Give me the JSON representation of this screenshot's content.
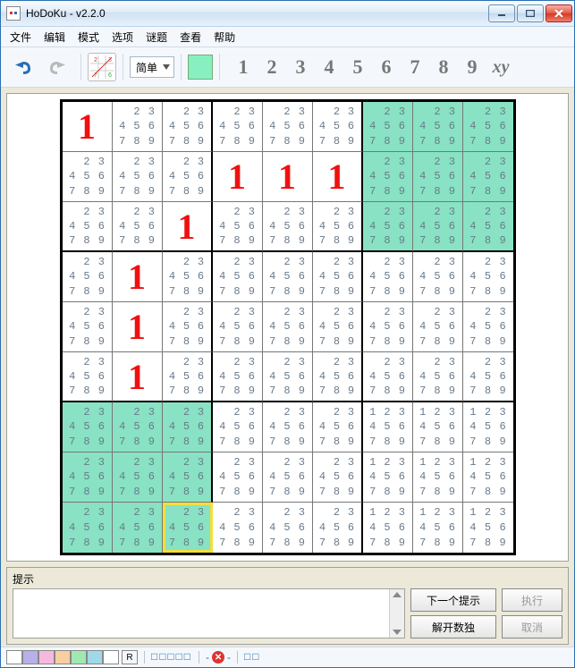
{
  "window": {
    "title": "HoDoKu - v2.2.0"
  },
  "menu": {
    "items": [
      "文件",
      "编辑",
      "模式",
      "选项",
      "谜题",
      "查看",
      "帮助"
    ]
  },
  "toolbar": {
    "difficulty_label": "简单",
    "numbers": [
      "1",
      "2",
      "3",
      "4",
      "5",
      "6",
      "7",
      "8",
      "9"
    ],
    "xy_label": "xy"
  },
  "hint": {
    "label": "提示",
    "btn_next": "下一个提示",
    "btn_solve": "解开数独",
    "btn_exec": "执行",
    "btn_cancel": "取消"
  },
  "status": {
    "palette": [
      "#ffffff",
      "#b8b0e8",
      "#f7b8e0",
      "#f7cfa0",
      "#a0e8b0",
      "#a0d8e8",
      "#ffffff"
    ],
    "r_label": "R",
    "boxes_text": "□□□□□",
    "boxes_text2": "□□"
  },
  "sudoku": {
    "selected": [
      8,
      2
    ],
    "cells": [
      [
        {
          "v": 1
        },
        {
          "c": [
            2,
            3,
            4,
            5,
            6,
            7,
            8,
            9
          ]
        },
        {
          "c": [
            2,
            3,
            4,
            5,
            6,
            7,
            8,
            9
          ]
        },
        {
          "c": [
            2,
            3,
            4,
            5,
            6,
            7,
            8,
            9
          ]
        },
        {
          "c": [
            2,
            3,
            4,
            5,
            6,
            7,
            8,
            9
          ]
        },
        {
          "c": [
            2,
            3,
            4,
            5,
            6,
            7,
            8,
            9
          ]
        },
        {
          "c": [
            2,
            3,
            4,
            5,
            6,
            7,
            8,
            9
          ],
          "hl": true
        },
        {
          "c": [
            2,
            3,
            4,
            5,
            6,
            7,
            8,
            9
          ],
          "hl": true
        },
        {
          "c": [
            2,
            3,
            4,
            5,
            6,
            7,
            8,
            9
          ],
          "hl": true
        }
      ],
      [
        {
          "c": [
            2,
            3,
            4,
            5,
            6,
            7,
            8,
            9
          ]
        },
        {
          "c": [
            2,
            3,
            4,
            5,
            6,
            7,
            8,
            9
          ]
        },
        {
          "c": [
            2,
            3,
            4,
            5,
            6,
            7,
            8,
            9
          ]
        },
        {
          "v": 1
        },
        {
          "v": 1
        },
        {
          "v": 1
        },
        {
          "c": [
            2,
            3,
            4,
            5,
            6,
            7,
            8,
            9
          ],
          "hl": true
        },
        {
          "c": [
            2,
            3,
            4,
            5,
            6,
            7,
            8,
            9
          ],
          "hl": true
        },
        {
          "c": [
            2,
            3,
            4,
            5,
            6,
            7,
            8,
            9
          ],
          "hl": true
        }
      ],
      [
        {
          "c": [
            2,
            3,
            4,
            5,
            6,
            7,
            8,
            9
          ]
        },
        {
          "c": [
            2,
            3,
            4,
            5,
            6,
            7,
            8,
            9
          ]
        },
        {
          "v": 1
        },
        {
          "c": [
            2,
            3,
            4,
            5,
            6,
            7,
            8,
            9
          ]
        },
        {
          "c": [
            2,
            3,
            4,
            5,
            6,
            7,
            8,
            9
          ]
        },
        {
          "c": [
            2,
            3,
            4,
            5,
            6,
            7,
            8,
            9
          ]
        },
        {
          "c": [
            2,
            3,
            4,
            5,
            6,
            7,
            8,
            9
          ],
          "hl": true
        },
        {
          "c": [
            2,
            3,
            4,
            5,
            6,
            7,
            8,
            9
          ],
          "hl": true
        },
        {
          "c": [
            2,
            3,
            4,
            5,
            6,
            7,
            8,
            9
          ],
          "hl": true
        }
      ],
      [
        {
          "c": [
            2,
            3,
            4,
            5,
            6,
            7,
            8,
            9
          ]
        },
        {
          "v": 1
        },
        {
          "c": [
            2,
            3,
            4,
            5,
            6,
            7,
            8,
            9
          ]
        },
        {
          "c": [
            2,
            3,
            4,
            5,
            6,
            7,
            8,
            9
          ]
        },
        {
          "c": [
            2,
            3,
            4,
            5,
            6,
            7,
            8,
            9
          ]
        },
        {
          "c": [
            2,
            3,
            4,
            5,
            6,
            7,
            8,
            9
          ]
        },
        {
          "c": [
            2,
            3,
            4,
            5,
            6,
            7,
            8,
            9
          ]
        },
        {
          "c": [
            2,
            3,
            4,
            5,
            6,
            7,
            8,
            9
          ]
        },
        {
          "c": [
            2,
            3,
            4,
            5,
            6,
            7,
            8,
            9
          ]
        }
      ],
      [
        {
          "c": [
            2,
            3,
            4,
            5,
            6,
            7,
            8,
            9
          ]
        },
        {
          "v": 1
        },
        {
          "c": [
            2,
            3,
            4,
            5,
            6,
            7,
            8,
            9
          ]
        },
        {
          "c": [
            2,
            3,
            4,
            5,
            6,
            7,
            8,
            9
          ]
        },
        {
          "c": [
            2,
            3,
            4,
            5,
            6,
            7,
            8,
            9
          ]
        },
        {
          "c": [
            2,
            3,
            4,
            5,
            6,
            7,
            8,
            9
          ]
        },
        {
          "c": [
            2,
            3,
            4,
            5,
            6,
            7,
            8,
            9
          ]
        },
        {
          "c": [
            2,
            3,
            4,
            5,
            6,
            7,
            8,
            9
          ]
        },
        {
          "c": [
            2,
            3,
            4,
            5,
            6,
            7,
            8,
            9
          ]
        }
      ],
      [
        {
          "c": [
            2,
            3,
            4,
            5,
            6,
            7,
            8,
            9
          ]
        },
        {
          "v": 1
        },
        {
          "c": [
            2,
            3,
            4,
            5,
            6,
            7,
            8,
            9
          ]
        },
        {
          "c": [
            2,
            3,
            4,
            5,
            6,
            7,
            8,
            9
          ]
        },
        {
          "c": [
            2,
            3,
            4,
            5,
            6,
            7,
            8,
            9
          ]
        },
        {
          "c": [
            2,
            3,
            4,
            5,
            6,
            7,
            8,
            9
          ]
        },
        {
          "c": [
            2,
            3,
            4,
            5,
            6,
            7,
            8,
            9
          ]
        },
        {
          "c": [
            2,
            3,
            4,
            5,
            6,
            7,
            8,
            9
          ]
        },
        {
          "c": [
            2,
            3,
            4,
            5,
            6,
            7,
            8,
            9
          ]
        }
      ],
      [
        {
          "c": [
            2,
            3,
            4,
            5,
            6,
            7,
            8,
            9
          ],
          "hl": true
        },
        {
          "c": [
            2,
            3,
            4,
            5,
            6,
            7,
            8,
            9
          ],
          "hl": true
        },
        {
          "c": [
            2,
            3,
            4,
            5,
            6,
            7,
            8,
            9
          ],
          "hl": true
        },
        {
          "c": [
            2,
            3,
            4,
            5,
            6,
            7,
            8,
            9
          ]
        },
        {
          "c": [
            2,
            3,
            4,
            5,
            6,
            7,
            8,
            9
          ]
        },
        {
          "c": [
            2,
            3,
            4,
            5,
            6,
            7,
            8,
            9
          ]
        },
        {
          "c": [
            1,
            2,
            3,
            4,
            5,
            6,
            7,
            8,
            9
          ]
        },
        {
          "c": [
            1,
            2,
            3,
            4,
            5,
            6,
            7,
            8,
            9
          ]
        },
        {
          "c": [
            1,
            2,
            3,
            4,
            5,
            6,
            7,
            8,
            9
          ]
        }
      ],
      [
        {
          "c": [
            2,
            3,
            4,
            5,
            6,
            7,
            8,
            9
          ],
          "hl": true
        },
        {
          "c": [
            2,
            3,
            4,
            5,
            6,
            7,
            8,
            9
          ],
          "hl": true
        },
        {
          "c": [
            2,
            3,
            4,
            5,
            6,
            7,
            8,
            9
          ],
          "hl": true
        },
        {
          "c": [
            2,
            3,
            4,
            5,
            6,
            7,
            8,
            9
          ]
        },
        {
          "c": [
            2,
            3,
            4,
            5,
            6,
            7,
            8,
            9
          ]
        },
        {
          "c": [
            2,
            3,
            4,
            5,
            6,
            7,
            8,
            9
          ]
        },
        {
          "c": [
            1,
            2,
            3,
            4,
            5,
            6,
            7,
            8,
            9
          ]
        },
        {
          "c": [
            1,
            2,
            3,
            4,
            5,
            6,
            7,
            8,
            9
          ]
        },
        {
          "c": [
            1,
            2,
            3,
            4,
            5,
            6,
            7,
            8,
            9
          ]
        }
      ],
      [
        {
          "c": [
            2,
            3,
            4,
            5,
            6,
            7,
            8,
            9
          ],
          "hl": true
        },
        {
          "c": [
            2,
            3,
            4,
            5,
            6,
            7,
            8,
            9
          ],
          "hl": true
        },
        {
          "c": [
            2,
            3,
            4,
            5,
            6,
            7,
            8,
            9
          ],
          "hl": true
        },
        {
          "c": [
            2,
            3,
            4,
            5,
            6,
            7,
            8,
            9
          ]
        },
        {
          "c": [
            2,
            3,
            4,
            5,
            6,
            7,
            8,
            9
          ]
        },
        {
          "c": [
            2,
            3,
            4,
            5,
            6,
            7,
            8,
            9
          ]
        },
        {
          "c": [
            1,
            2,
            3,
            4,
            5,
            6,
            7,
            8,
            9
          ]
        },
        {
          "c": [
            1,
            2,
            3,
            4,
            5,
            6,
            7,
            8,
            9
          ]
        },
        {
          "c": [
            1,
            2,
            3,
            4,
            5,
            6,
            7,
            8,
            9
          ]
        }
      ]
    ]
  }
}
